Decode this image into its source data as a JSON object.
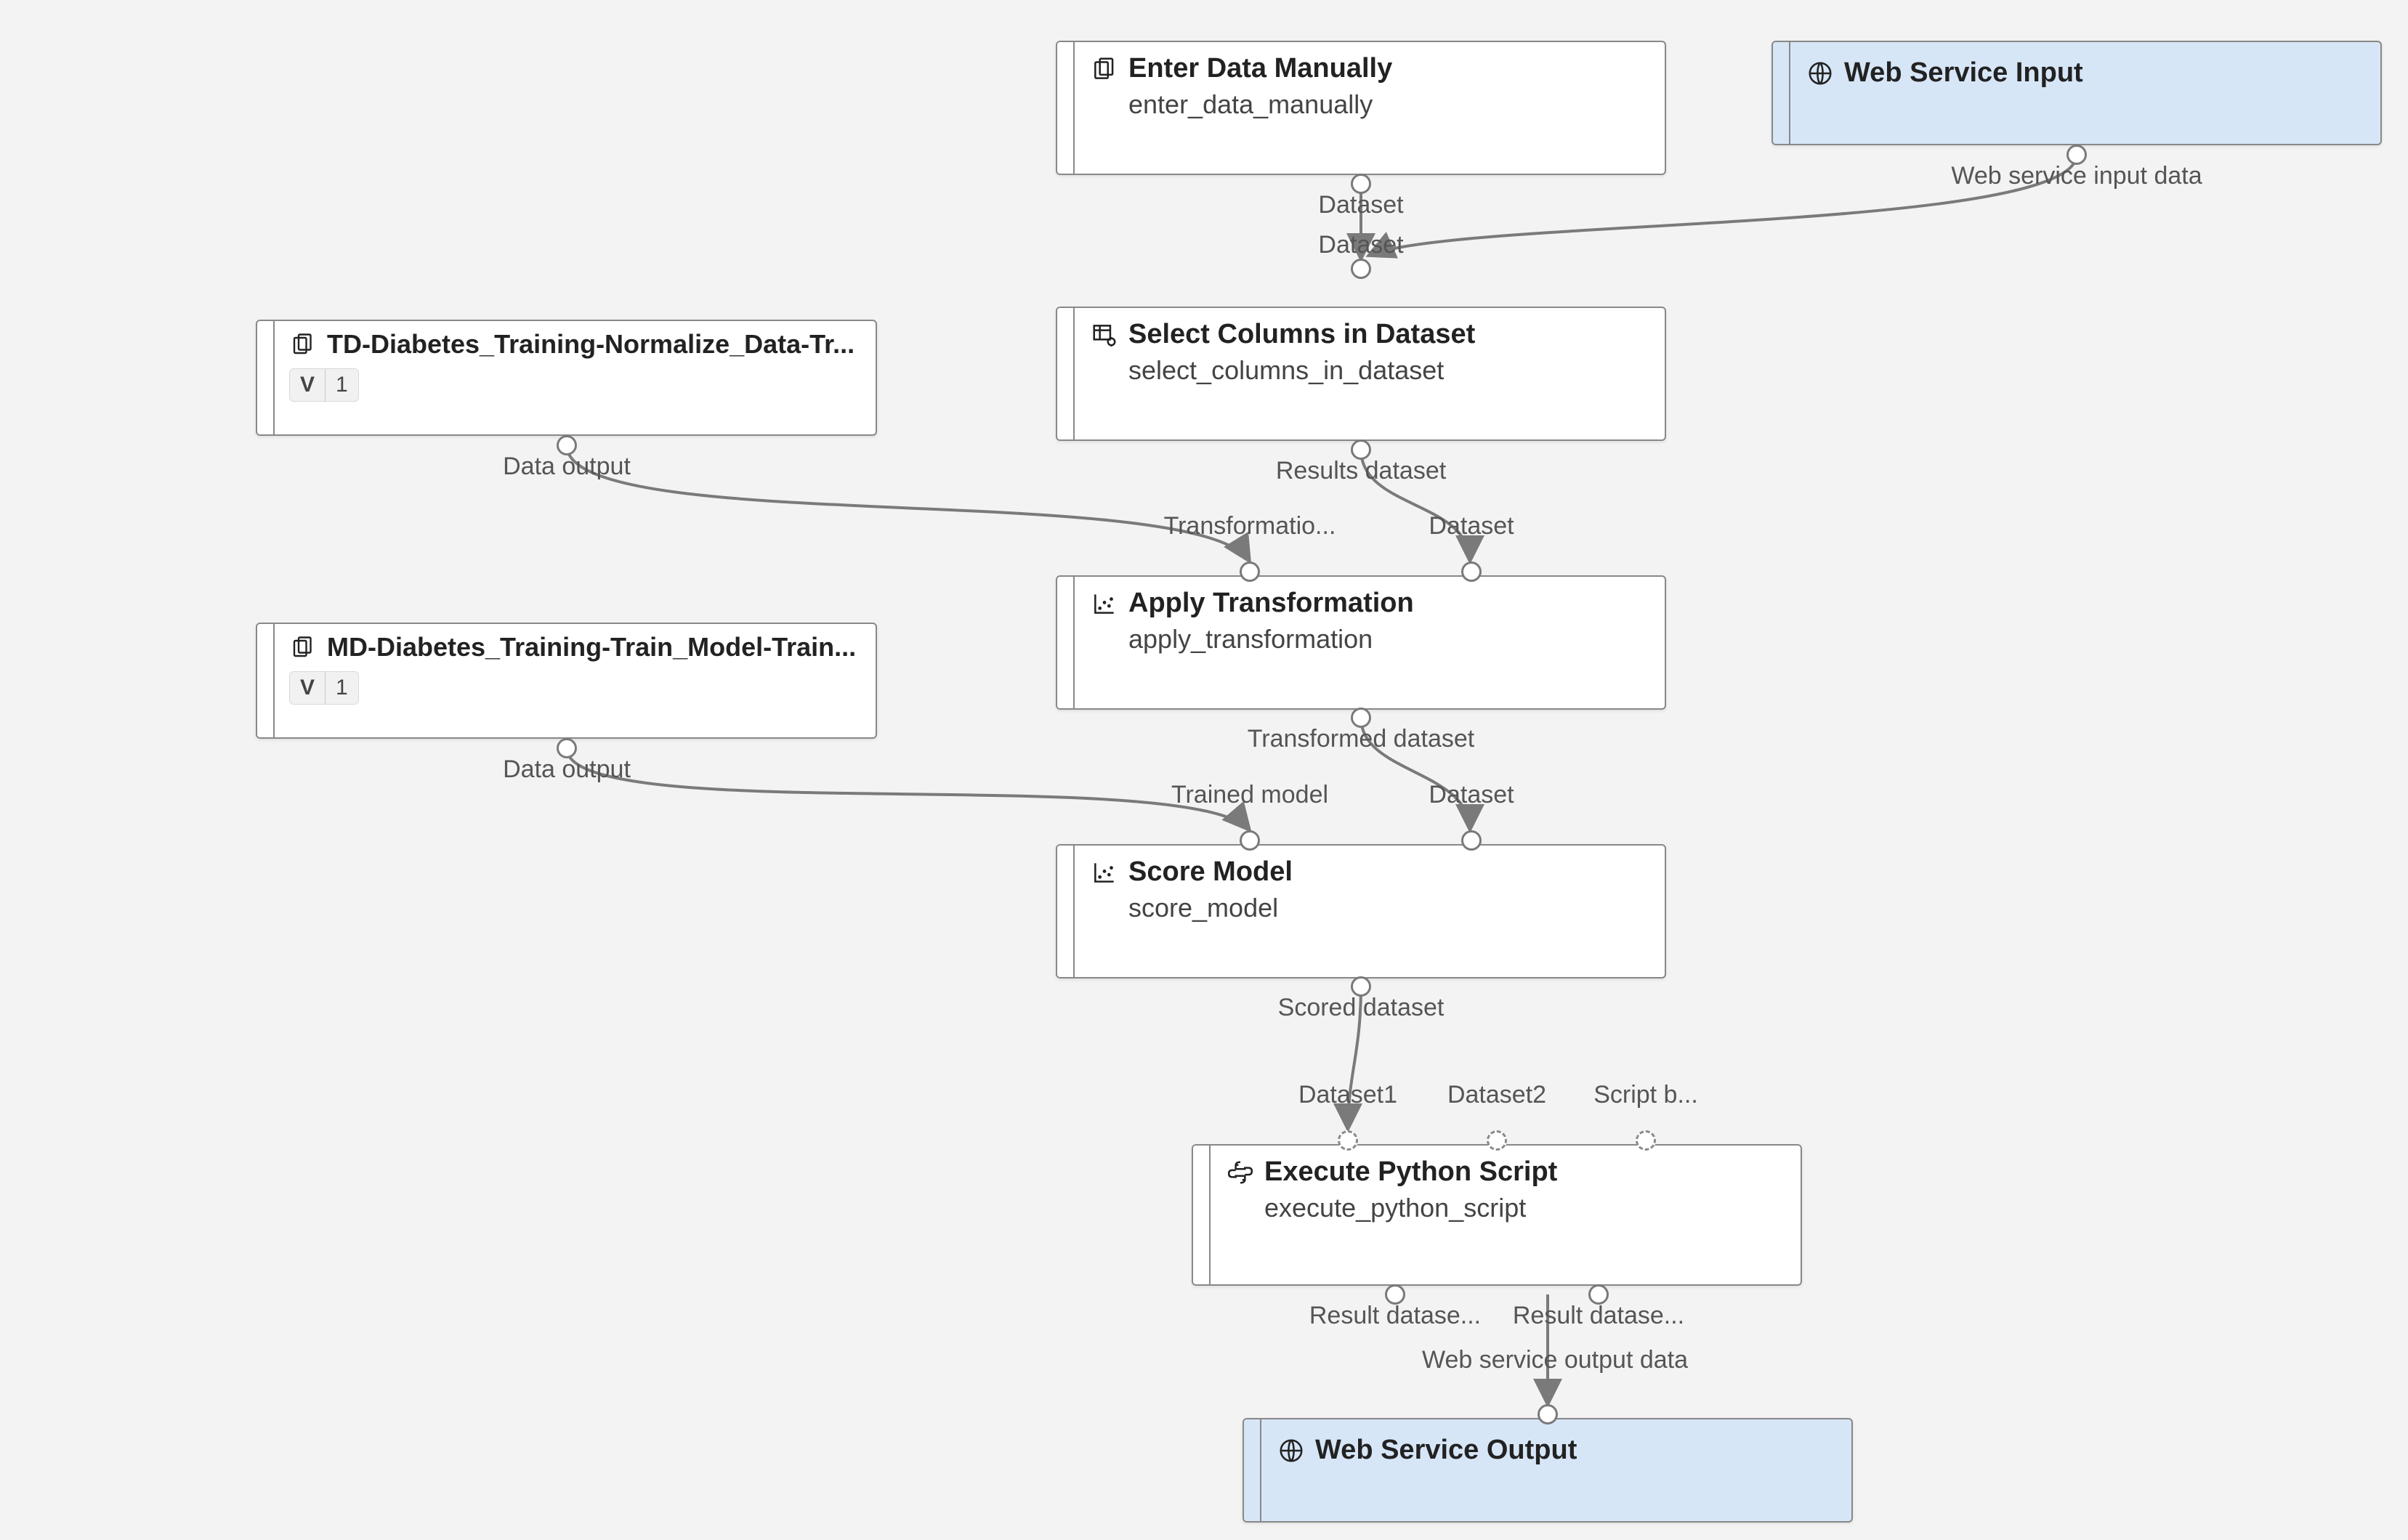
{
  "nodes": {
    "enter_data": {
      "title": "Enter Data Manually",
      "subtitle": "enter_data_manually",
      "icon": "multi-doc-icon"
    },
    "ws_input": {
      "title": "Web Service Input",
      "icon": "globe-icon"
    },
    "td": {
      "title": "TD-Diabetes_Training-Normalize_Data-Tr...",
      "version": "1",
      "icon": "multi-doc-icon"
    },
    "select_cols": {
      "title": "Select Columns in Dataset",
      "subtitle": "select_columns_in_dataset",
      "icon": "table-gear-icon"
    },
    "apply_tr": {
      "title": "Apply Transformation",
      "subtitle": "apply_transformation",
      "icon": "scatter-icon"
    },
    "md": {
      "title": "MD-Diabetes_Training-Train_Model-Train...",
      "version": "1",
      "icon": "multi-doc-icon"
    },
    "score": {
      "title": "Score Model",
      "subtitle": "score_model",
      "icon": "scatter-icon"
    },
    "python": {
      "title": "Execute Python Script",
      "subtitle": "execute_python_script",
      "icon": "python-icon"
    },
    "ws_output": {
      "title": "Web Service Output",
      "icon": "globe-icon"
    }
  },
  "port_labels": {
    "enter_out": "Dataset",
    "ws_in_out": "Web service input data",
    "sel_in": "Dataset",
    "sel_out": "Results dataset",
    "td_out": "Data output",
    "apply_in_t": "Transformatio...",
    "apply_in_d": "Dataset",
    "apply_out": "Transformed dataset",
    "md_out": "Data output",
    "score_in_m": "Trained model",
    "score_in_d": "Dataset",
    "score_out": "Scored dataset",
    "py_in1": "Dataset1",
    "py_in2": "Dataset2",
    "py_in3": "Script b...",
    "py_out1": "Result datase...",
    "py_out2": "Result datase...",
    "ws_out_in": "Web service output data"
  }
}
